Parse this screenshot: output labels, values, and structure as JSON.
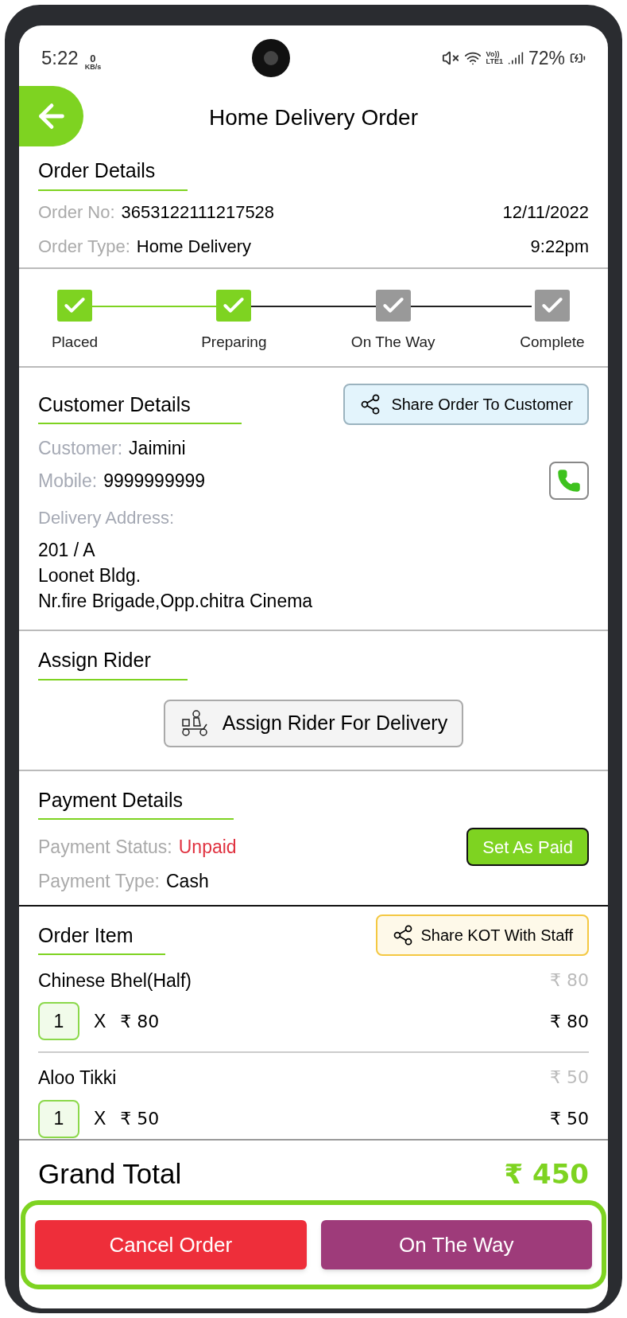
{
  "status_bar": {
    "time": "5:22",
    "net_speed": "0",
    "net_unit": "KB/s",
    "network": [
      "Vo))",
      "LTE1"
    ],
    "battery": "72%"
  },
  "header": {
    "title": "Home Delivery Order"
  },
  "order_details": {
    "heading": "Order Details",
    "rows": [
      {
        "label": "Order No:",
        "value": "3653122111217528",
        "right": "12/11/2022"
      },
      {
        "label": "Order Type:",
        "value": "Home Delivery",
        "right": "9:22pm"
      }
    ]
  },
  "steps": [
    {
      "label": "Placed",
      "reached": true
    },
    {
      "label": "Preparing",
      "reached": true
    },
    {
      "label": "On The Way",
      "reached": false
    },
    {
      "label": "Complete",
      "reached": false
    }
  ],
  "customer": {
    "heading": "Customer Details",
    "share_button": "Share Order To Customer",
    "name_label": "Customer:",
    "name": "Jaimini",
    "mobile_label": "Mobile:",
    "mobile": "9999999999",
    "address_label": "Delivery Address:",
    "address_lines": [
      "201 / A",
      "Loonet Bldg.",
      "Nr.fire Brigade,Opp.chitra Cinema"
    ]
  },
  "rider": {
    "heading": "Assign Rider",
    "button": "Assign Rider For Delivery"
  },
  "payment": {
    "heading": "Payment Details",
    "status_label": "Payment Status:",
    "status": "Unpaid",
    "paid": false,
    "button": "Set As Paid",
    "type_label": "Payment Type:",
    "type": "Cash"
  },
  "order_items": {
    "heading": "Order Item",
    "share_button": "Share KOT With Staff",
    "items": [
      {
        "name": "Chinese Bhel(Half)",
        "unit_price": "₹ 80",
        "qty": "1",
        "times": "X",
        "price": "₹ 80",
        "total": "₹ 80"
      },
      {
        "name": "Aloo Tikki",
        "unit_price": "₹ 50",
        "qty": "1",
        "times": "X",
        "price": "₹ 50",
        "total": "₹ 50"
      }
    ]
  },
  "grand_total": {
    "label": "Grand Total",
    "value": "₹ 450"
  },
  "actions": [
    {
      "label": "Cancel Order",
      "kind": "danger"
    },
    {
      "label": "On The Way",
      "kind": "primary"
    }
  ]
}
